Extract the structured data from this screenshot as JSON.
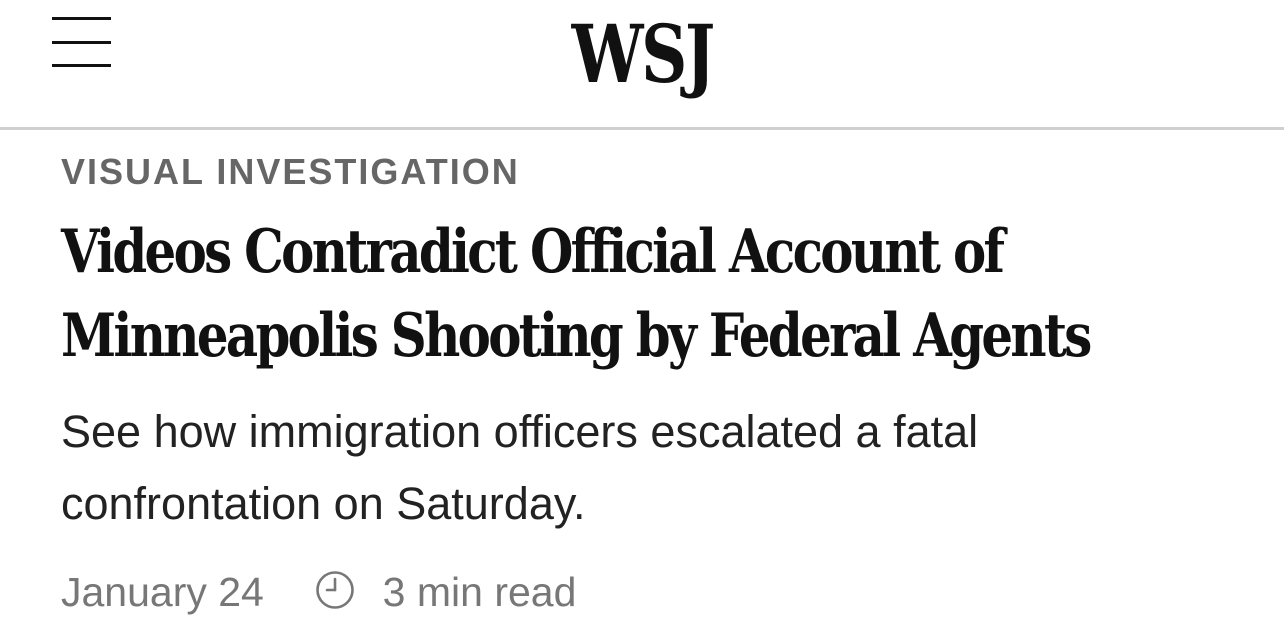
{
  "header": {
    "logo_text": "WSJ",
    "menu_icon": "hamburger-menu-icon"
  },
  "article": {
    "kicker": "VISUAL INVESTIGATION",
    "headline_lines": [
      "Videos Contradict Official Account of",
      "Minneapolis Shooting by Federal Agents"
    ],
    "dek_lines": [
      "See how immigration officers escalated a fatal",
      "confrontation on Saturday."
    ],
    "date": "January 24",
    "read_time": "3 min read",
    "read_time_icon": "clock-icon"
  },
  "colors": {
    "text": "#111111",
    "kicker": "#666666",
    "meta": "#777777",
    "divider": "#d0d0d0"
  }
}
